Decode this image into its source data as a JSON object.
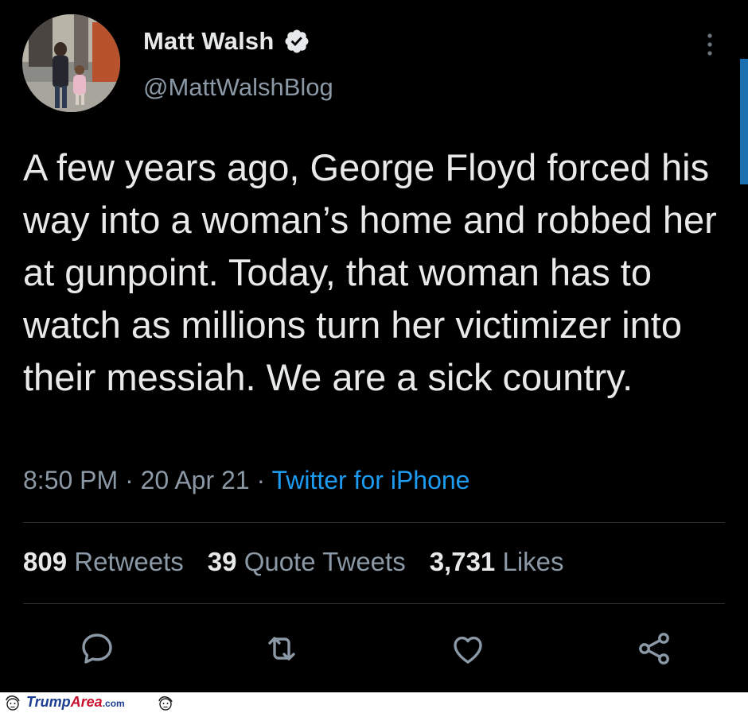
{
  "profile": {
    "display_name": "Matt Walsh",
    "handle": "@MattWalshBlog",
    "verified": true
  },
  "tweet": {
    "text": "A few years ago, George Floyd forced his way into a woman’s home and robbed her at gunpoint. Today, that woman has to watch as millions turn her victimizer into their messiah. We are a sick country.",
    "time": "8:50 PM",
    "separator": "·",
    "date": "20 Apr 21",
    "source": "Twitter for iPhone"
  },
  "stats": {
    "retweets_count": "809",
    "retweets_label": "Retweets",
    "quotes_count": "39",
    "quotes_label": "Quote Tweets",
    "likes_count": "3,731",
    "likes_label": "Likes"
  },
  "actions": [
    "reply-icon",
    "retweet-icon",
    "like-icon",
    "share-icon"
  ],
  "footer": {
    "brand_part1": "Trump",
    "brand_part2": "Area",
    "brand_part3": ".com"
  },
  "colors": {
    "background": "#000000",
    "text": "#e7e9ea",
    "secondary": "#8b98a5",
    "link": "#1d9bf0",
    "divider": "#2f3336"
  }
}
